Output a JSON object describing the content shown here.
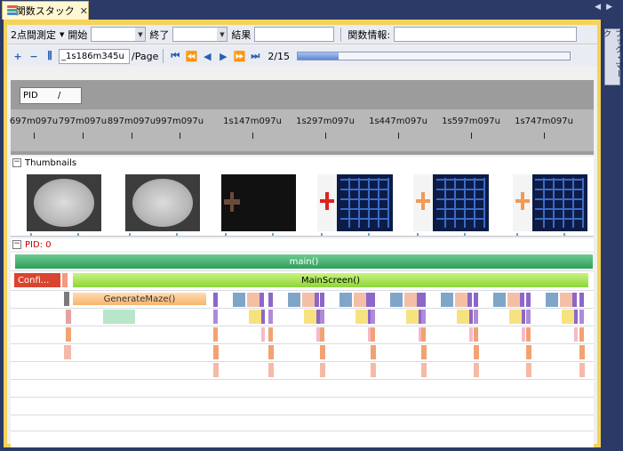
{
  "tab": {
    "title": "関数スタック",
    "close": "✕"
  },
  "side_panel": {
    "label": "ブック・マーク"
  },
  "toolbar1": {
    "mode_label": "2点間測定",
    "start_label": "開始",
    "end_label": "終了",
    "result_label": "結果",
    "func_info_label": "関数情報:",
    "start_value": "",
    "end_value": "",
    "result_value": "",
    "func_info_value": ""
  },
  "toolbar2": {
    "zoom_in": "+",
    "zoom_out": "−",
    "fit": "⫼",
    "page_value": "_1s186m345u",
    "page_unit": "/Page",
    "first": "⏮",
    "fast_back": "⏪",
    "back": "◀",
    "forward": "▶",
    "fast_forward": "⏩",
    "last": "⏭",
    "page_counter": "2/15",
    "progress": 0.15
  },
  "ruler": {
    "header": "PID",
    "header_sep": "/",
    "labels": [
      "697m097u",
      "797m097u",
      "897m097u",
      "997m097u",
      "1s147m097u",
      "1s297m097u",
      "1s447m097u",
      "1s597m097u",
      "1s747m097u"
    ]
  },
  "thumbnails": {
    "title": "Thumbnails",
    "toggle": "−"
  },
  "pid_section": {
    "title": "PID: 0",
    "toggle": "−"
  },
  "tracks": {
    "main": "main()",
    "config": "Confi...",
    "mainscreen": "MainScreen()",
    "generate_maze": "GenerateMaze()"
  },
  "colors": {
    "accent_tab": "#f5d35a",
    "main_bar": "#2e9e5a",
    "mainscreen_bar": "#8dd63a",
    "config_bar": "#d9452f",
    "generate_maze_bar": "#f7b56d",
    "pid_title": "#cc0000"
  }
}
